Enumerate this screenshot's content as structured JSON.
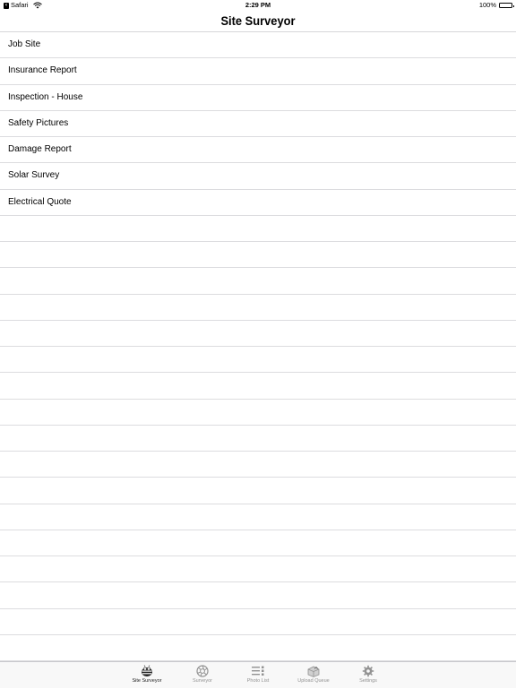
{
  "status_bar": {
    "back_app": "Safari",
    "time": "2:29 PM",
    "battery_percent": "100%"
  },
  "nav": {
    "title": "Site Surveyor"
  },
  "list_items": [
    "Job Site",
    "Insurance Report",
    "Inspection - House",
    "Safety Pictures",
    "Damage Report",
    "Solar Survey",
    "Electrical Quote"
  ],
  "tabs": [
    {
      "label": "Site Surveyor",
      "icon": "bee-icon",
      "active": true
    },
    {
      "label": "Surveyor",
      "icon": "camera-aperture-icon",
      "active": false
    },
    {
      "label": "Photo List",
      "icon": "list-icon",
      "active": false
    },
    {
      "label": "Upload Queue",
      "icon": "upload-box-icon",
      "active": false
    },
    {
      "label": "Settings",
      "icon": "gear-icon",
      "active": false
    }
  ]
}
